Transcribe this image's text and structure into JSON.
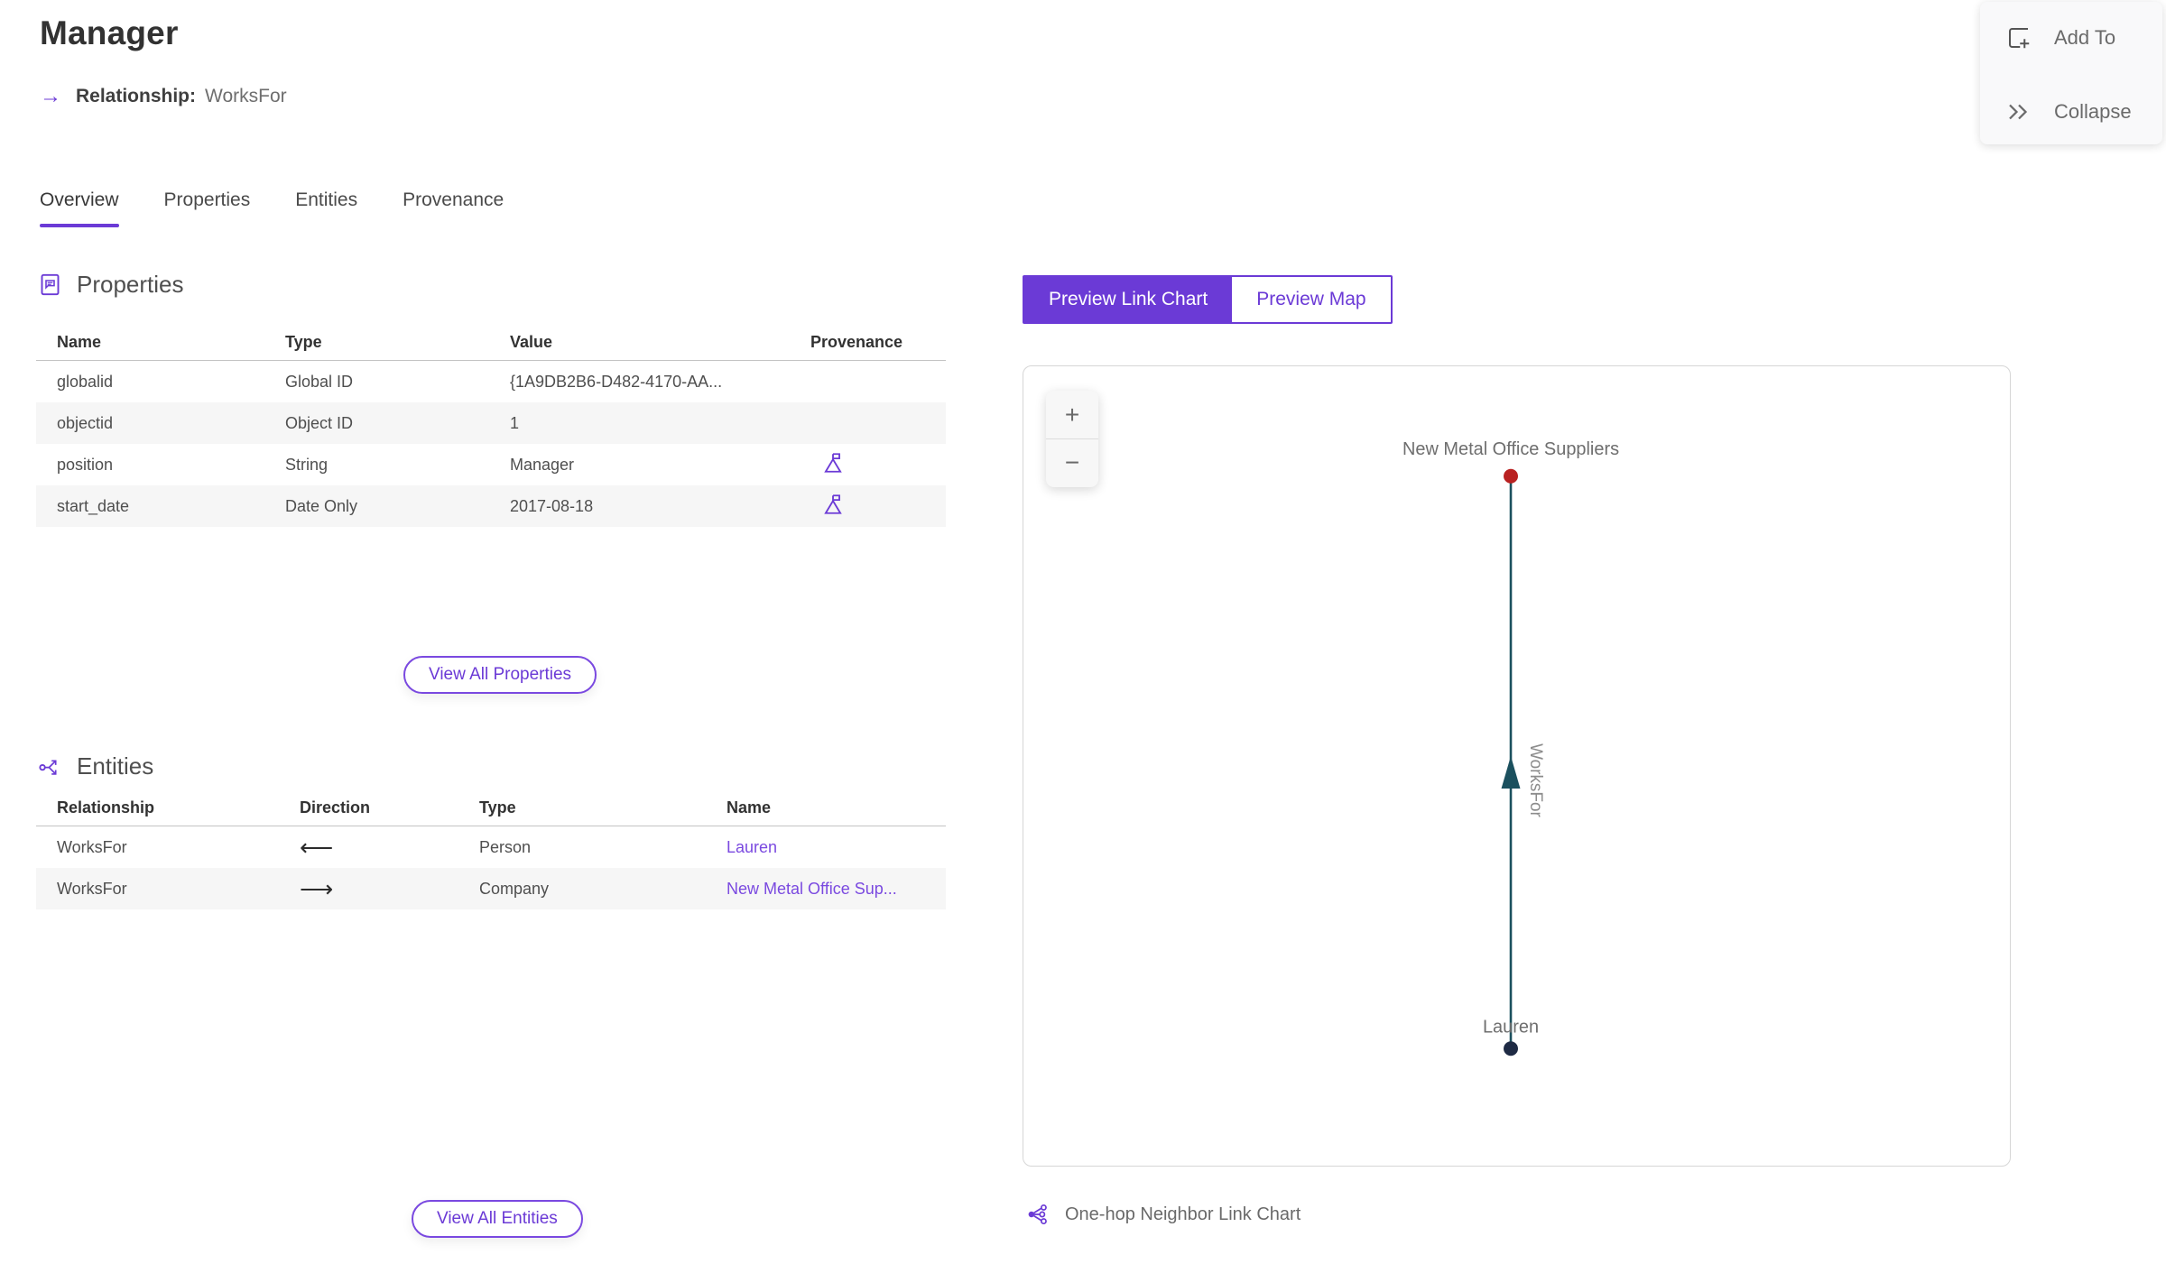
{
  "header": {
    "title": "Manager",
    "subtitle_arrow": "→",
    "subtitle_label": "Relationship:",
    "subtitle_value": "WorksFor"
  },
  "actions": {
    "add_to": "Add To",
    "collapse": "Collapse"
  },
  "tabs": [
    {
      "label": "Overview"
    },
    {
      "label": "Properties"
    },
    {
      "label": "Entities"
    },
    {
      "label": "Provenance"
    }
  ],
  "properties_section": {
    "heading": "Properties",
    "columns": [
      "Name",
      "Type",
      "Value",
      "Provenance"
    ],
    "rows": [
      {
        "name": "globalid",
        "type": "Global ID",
        "value": "{1A9DB2B6-D482-4170-AA..."
      },
      {
        "name": "objectid",
        "type": "Object ID",
        "value": "1"
      },
      {
        "name": "position",
        "type": "String",
        "value": "Manager"
      },
      {
        "name": "start_date",
        "type": "Date Only",
        "value": "2017-08-18"
      }
    ],
    "view_all_label": "View All Properties"
  },
  "entities_section": {
    "heading": "Entities",
    "columns": [
      "Relationship",
      "Direction",
      "Type",
      "Name"
    ],
    "rows": [
      {
        "relationship": "WorksFor",
        "direction": "⟵",
        "type": "Person",
        "name": "Lauren"
      },
      {
        "relationship": "WorksFor",
        "direction": "⟶",
        "type": "Company",
        "name": "New Metal Office Sup..."
      }
    ],
    "view_all_label": "View All Entities"
  },
  "preview": {
    "toggle": [
      {
        "label": "Preview Link Chart"
      },
      {
        "label": "Preview Map"
      }
    ],
    "zoom_in_label": "+",
    "zoom_out_label": "−",
    "caption": "One-hop Neighbor Link Chart",
    "link_chart": {
      "nodes": [
        {
          "label": "New Metal Office Suppliers",
          "color": "#b92121"
        },
        {
          "label": "Lauren",
          "color": "#1e2a44"
        }
      ],
      "edge": {
        "label": "WorksFor",
        "color": "#1b505e",
        "direction": "up"
      }
    }
  },
  "colors": {
    "accent": "#6b3ad6",
    "link": "#7a49e0",
    "edge_teal": "#1b505e",
    "node_red": "#b92121",
    "node_navy": "#1e2a44",
    "row_stripe": "#f6f6f6"
  }
}
